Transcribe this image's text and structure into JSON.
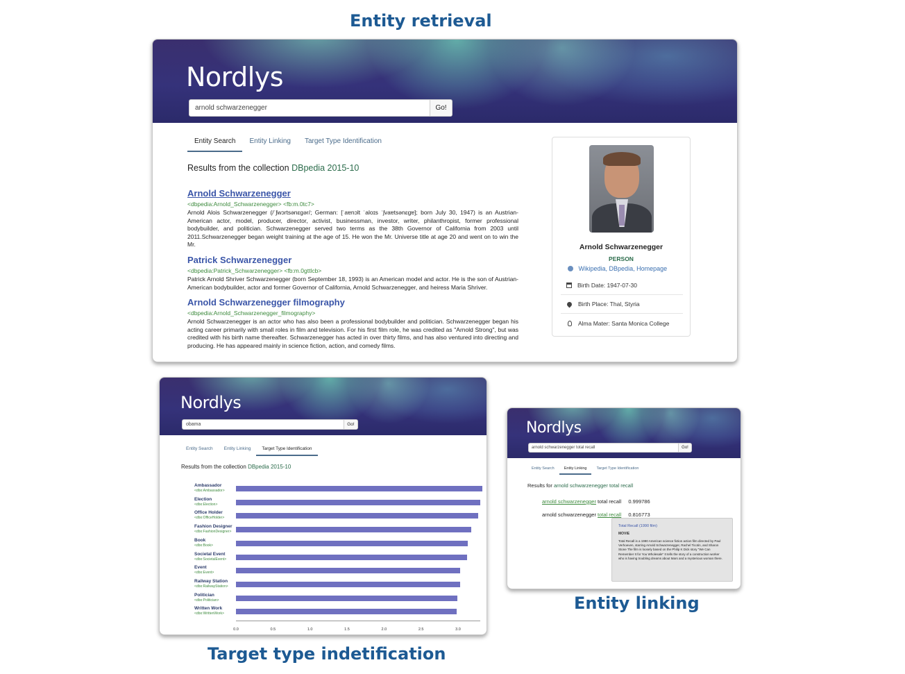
{
  "captions": {
    "entity_retrieval": "Entity retrieval",
    "target_type": "Target type indetification",
    "entity_linking": "Entity linking"
  },
  "retrieval": {
    "logo": "Nordlys",
    "query": "arnold schwarzenegger",
    "go": "Go!",
    "tabs": [
      "Entity Search",
      "Entity Linking",
      "Target Type Identification"
    ],
    "results_prefix": "Results from the collection",
    "collection": "DBpedia 2015-10",
    "results": [
      {
        "title": "Arnold Schwarzenegger",
        "uri": "<dbpedia:Arnold_Schwarzenegger>  <fb:m.0tc7>",
        "text": "Arnold Alois Schwarzenegger (/ˈʃwɔrtsənɛgər/; German: [ˈaɐnɔlt ˈaloɪs ˈʃvaɐtsənɛgɐ]; born July 30, 1947) is an Austrian-American actor, model, producer, director, activist, businessman, investor, writer, philanthropist, former professional bodybuilder, and politician. Schwarzenegger served two terms as the 38th Governor of California from 2003 until 2011.Schwarzenegger began weight training at the age of 15. He won the Mr. Universe title at age 20 and went on to win the Mr."
      },
      {
        "title": "Patrick Schwarzenegger",
        "uri": "<dbpedia:Patrick_Schwarzenegger>  <fb:m.0gttlcb>",
        "text": "Patrick Arnold Shriver Schwarzenegger (born September 18, 1993) is an American model and actor. He is the son of Austrian-American bodybuilder, actor and former Governor of California, Arnold Schwarzenegger, and heiress Maria Shriver."
      },
      {
        "title": "Arnold Schwarzenegger filmography",
        "uri": "<dbpedia:Arnold_Schwarzenegger_filmography>",
        "text": "Arnold Schwarzenegger is an actor who has also been a professional bodybuilder and politician. Schwarzenegger began his acting career primarily with small roles in film and television. For his first film role, he was credited as \"Arnold Strong\", but was credited with his birth name thereafter. Schwarzenegger has acted in over thirty films, and has also ventured into directing and producing. He has appeared mainly in science fiction, action, and comedy films."
      }
    ],
    "card": {
      "name": "Arnold Schwarzenegger",
      "type": "PERSON",
      "links": [
        "Wikipedia,",
        "DBpedia,",
        "Homepage"
      ],
      "facts": [
        {
          "icon": "calendar-icon",
          "text": "Birth Date: 1947-07-30"
        },
        {
          "icon": "map-pin-icon",
          "text": "Birth Place: Thal, Styria"
        },
        {
          "icon": "lightbulb-icon",
          "text": "Alma Mater: Santa Monica College"
        }
      ]
    }
  },
  "target_type": {
    "logo": "Nordlys",
    "query": "obama",
    "go": "Go!",
    "tabs": [
      "Entity Search",
      "Entity Linking",
      "Target Type Identification"
    ],
    "results_prefix": "Results from the collection",
    "collection": "DBpedia 2015-10"
  },
  "chart_data": {
    "type": "bar",
    "orientation": "horizontal",
    "categories": [
      "Ambassador",
      "Election",
      "Office Holder",
      "Fashion Designer",
      "Book",
      "Societal Event",
      "Event",
      "Railway Station",
      "Politician",
      "Written Work"
    ],
    "category_uris": [
      "<dbo:Ambassador>",
      "<dbo:Election>",
      "<dbo:OfficeHolder>",
      "<dbo:FashionDesigner>",
      "<dbo:Book>",
      "<dbo:SocietalEvent>",
      "<dbo:Event>",
      "<dbo:RailwayStation>",
      "<dbo:Politician>",
      "<dbo:WrittenWork>"
    ],
    "values": [
      3.33,
      3.3,
      3.27,
      3.18,
      3.13,
      3.12,
      3.03,
      3.03,
      2.99,
      2.98
    ],
    "xlim": [
      0,
      3.3
    ],
    "xticks": [
      "0.0",
      "0.5",
      "1.0",
      "1.5",
      "2.0",
      "2.5",
      "3.0"
    ],
    "color": "#6f70c0"
  },
  "linking": {
    "logo": "Nordlys",
    "query": "arnold schwarzenegger total recall",
    "go": "Go!",
    "tabs": [
      "Entity Search",
      "Entity Linking",
      "Target Type Identification"
    ],
    "results_prefix": "Results for",
    "results_query": "arnold schwarzenegger total recall",
    "rows": [
      {
        "pre": "",
        "link": "arnold schwarzenegger",
        "post": " total recall",
        "score": "0.999786"
      },
      {
        "pre": "arnold schwarzenegger ",
        "link": "total recall",
        "post": "",
        "score": "0.816773"
      }
    ],
    "tooltip": {
      "title": "Total Recall (1990 film)",
      "type": "MOVIE",
      "text": "Total Recall is a 1990 American science fiction action film directed by Paul Verhoeven, starring Arnold Schwarzenegger, Rachel Ticotin, and Sharon Stone The film is loosely based on the Philip K Dick story \"We Can Remember It for You Wholesale\" It tells the story of a construction worker who is having troubling dreams about Mars and a mysterious woman there."
    }
  }
}
